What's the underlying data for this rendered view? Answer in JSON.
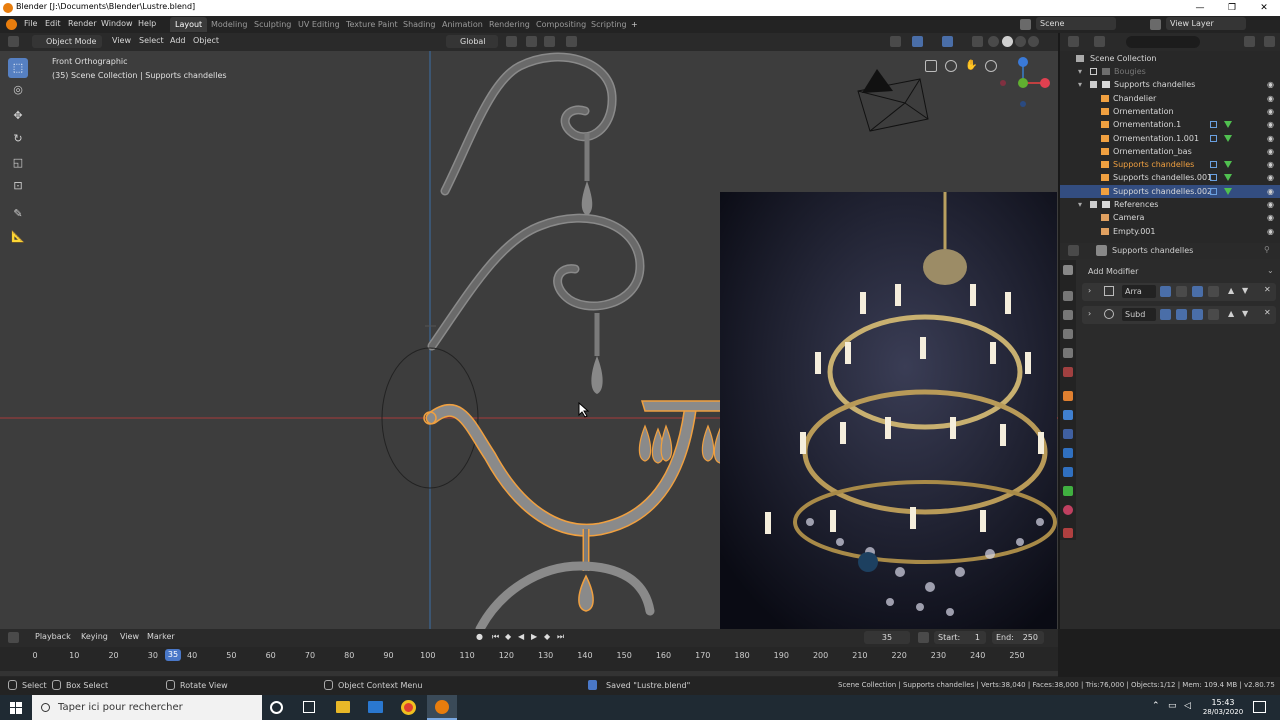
{
  "window": {
    "title": "Blender [J:\\Documents\\Blender\\Lustre.blend]",
    "controls": [
      "—",
      "❐",
      "✕"
    ]
  },
  "menubar": {
    "menus": [
      "File",
      "Edit",
      "Render",
      "Window",
      "Help"
    ],
    "workspaces": [
      "Layout",
      "Modeling",
      "Sculpting",
      "UV Editing",
      "Texture Paint",
      "Shading",
      "Animation",
      "Rendering",
      "Compositing",
      "Scripting"
    ],
    "active_workspace": "Layout",
    "add_tab": "+",
    "scene": "Scene",
    "view_layer": "View Layer"
  },
  "viewport_header": {
    "mode": "Object Mode",
    "menus": [
      "View",
      "Select",
      "Add",
      "Object"
    ],
    "orientation": "Global"
  },
  "viewport": {
    "view_name": "Front Orthographic",
    "collection_info": "(35) Scene Collection | Supports chandelles",
    "background_color": "#3d3d3d",
    "x_axis_color": "#a83a3a",
    "z_axis_color": "#3a6ea8",
    "selection_color": "#f0a040"
  },
  "outliner": {
    "title": "Scene Collection",
    "rows": [
      {
        "label": "Bougies",
        "indent": 2,
        "icon": "collection",
        "dim": true
      },
      {
        "label": "Supports chandelles",
        "indent": 2,
        "icon": "collection"
      },
      {
        "label": "Chandelier",
        "indent": 3,
        "icon": "mesh"
      },
      {
        "label": "Ornementation",
        "indent": 3,
        "icon": "mesh"
      },
      {
        "label": "Ornementation.1",
        "indent": 3,
        "icon": "mesh"
      },
      {
        "label": "Ornementation.1.001",
        "indent": 3,
        "icon": "mesh"
      },
      {
        "label": "Ornementation_bas",
        "indent": 3,
        "icon": "mesh"
      },
      {
        "label": "Supports chandelles",
        "indent": 3,
        "icon": "mesh",
        "highlight": true
      },
      {
        "label": "Supports chandelles.001",
        "indent": 3,
        "icon": "mesh"
      },
      {
        "label": "Supports chandelles.002",
        "indent": 3,
        "icon": "mesh",
        "selected": true
      },
      {
        "label": "References",
        "indent": 2,
        "icon": "collection"
      },
      {
        "label": "Camera",
        "indent": 3,
        "icon": "camera"
      },
      {
        "label": "Empty.001",
        "indent": 3,
        "icon": "empty"
      }
    ]
  },
  "properties": {
    "object_name": "Supports chandelles",
    "add_modifier": "Add Modifier",
    "modifiers": [
      {
        "name": "Arra"
      },
      {
        "name": "Subd"
      }
    ]
  },
  "timeline": {
    "menus": [
      "Playback",
      "Keying",
      "View",
      "Marker"
    ],
    "current_frame": "35",
    "start_label": "Start:",
    "start": "1",
    "end_label": "End:",
    "end": "250",
    "frame_ticks": [
      "0",
      "10",
      "20",
      "30",
      "40",
      "50",
      "60",
      "70",
      "80",
      "90",
      "100",
      "110",
      "120",
      "130",
      "140",
      "150",
      "160",
      "170",
      "180",
      "190",
      "200",
      "210",
      "220",
      "230",
      "240",
      "250"
    ]
  },
  "statusbar": {
    "select": "Select",
    "box_select": "Box Select",
    "rotate_view": "Rotate View",
    "context_menu": "Object Context Menu",
    "saved_message": "Saved \"Lustre.blend\"",
    "stats": "Scene Collection | Supports chandelles | Verts:38,040 | Faces:38,000 | Tris:76,000 | Objects:1/12 | Mem: 109.4 MB | v2.80.75"
  },
  "taskbar": {
    "search_placeholder": "Taper ici pour rechercher",
    "time": "15:43",
    "date": "28/03/2020"
  }
}
